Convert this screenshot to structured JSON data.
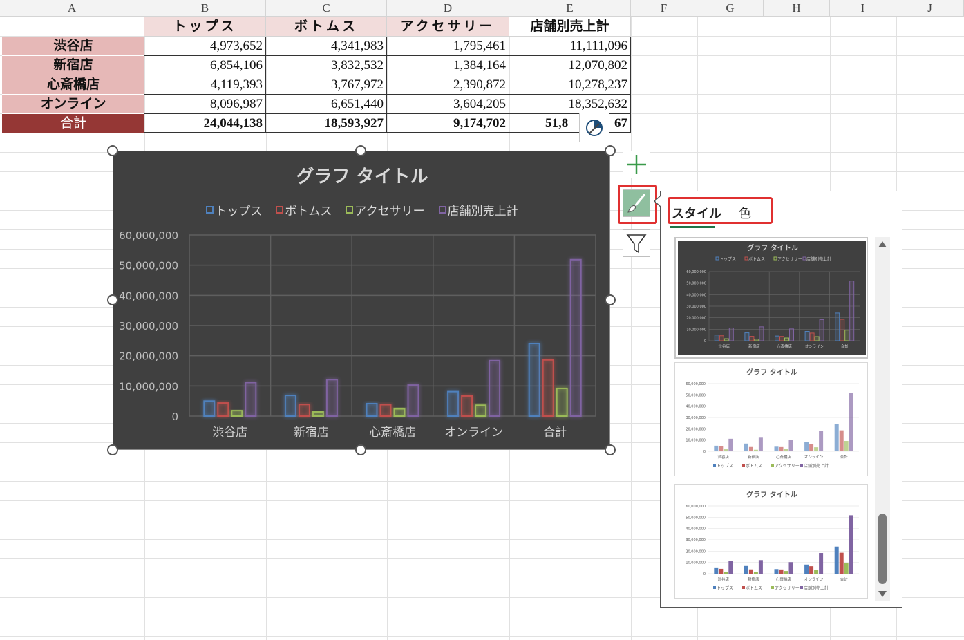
{
  "columns": [
    "A",
    "B",
    "C",
    "D",
    "E",
    "F",
    "G",
    "H",
    "I",
    "J"
  ],
  "table": {
    "headers": [
      "トップス",
      "ボトムス",
      "アクセサリー",
      "店舗別売上計"
    ],
    "rows": [
      {
        "label": "渋谷店",
        "values": [
          "4,973,652",
          "4,341,983",
          "1,795,461",
          "11,111,096"
        ]
      },
      {
        "label": "新宿店",
        "values": [
          "6,854,106",
          "3,832,532",
          "1,384,164",
          "12,070,802"
        ]
      },
      {
        "label": "心斎橋店",
        "values": [
          "4,119,393",
          "3,767,972",
          "2,390,872",
          "10,278,237"
        ]
      },
      {
        "label": "オンライン",
        "values": [
          "8,096,987",
          "6,651,440",
          "3,604,205",
          "18,352,632"
        ]
      }
    ],
    "total": {
      "label": "合計",
      "values": [
        "24,044,138",
        "18,593,927",
        "9,174,702",
        "51,8",
        "67"
      ]
    }
  },
  "chart_data": {
    "type": "bar",
    "title": "グラフ タイトル",
    "categories": [
      "渋谷店",
      "新宿店",
      "心斎橋店",
      "オンライン",
      "合計"
    ],
    "series": [
      {
        "name": "トップス",
        "color": "#4f81bd",
        "values": [
          4973652,
          6854106,
          4119393,
          8096987,
          24044138
        ]
      },
      {
        "name": "ボトムス",
        "color": "#c0504d",
        "values": [
          4341983,
          3832532,
          3767972,
          6651440,
          18593927
        ]
      },
      {
        "name": "アクセサリー",
        "color": "#9bbb59",
        "values": [
          1795461,
          1384164,
          2390872,
          3604205,
          9174702
        ]
      },
      {
        "name": "店舗別売上計",
        "color": "#8064a2",
        "values": [
          11111096,
          12070802,
          10278237,
          18352632,
          51796863
        ]
      }
    ],
    "ylim": [
      0,
      60000000
    ],
    "yticks": [
      "0",
      "10,000,000",
      "20,000,000",
      "30,000,000",
      "40,000,000",
      "50,000,000",
      "60,000,000"
    ],
    "legend": "top",
    "grid": true,
    "background": "#404040"
  },
  "side_buttons": {
    "elements": "chart-elements-plus-icon",
    "styles": "paintbrush-icon",
    "filters": "funnel-icon"
  },
  "style_panel": {
    "tabs": [
      "スタイル",
      "色"
    ],
    "active_tab": "スタイル",
    "thumb_title": "グラフ タイトル",
    "thumb_yticks": [
      "60,000,000",
      "50,000,000",
      "40,000,000",
      "30,000,000",
      "20,000,000",
      "10,000,000",
      "0"
    ],
    "thumb_categories": [
      "渋谷店",
      "新宿店",
      "心斎橋店",
      "オンライン",
      "合計"
    ],
    "thumb_legend": [
      "トップス",
      "ボトムス",
      "アクセサリー",
      "店舗別売上計"
    ]
  }
}
